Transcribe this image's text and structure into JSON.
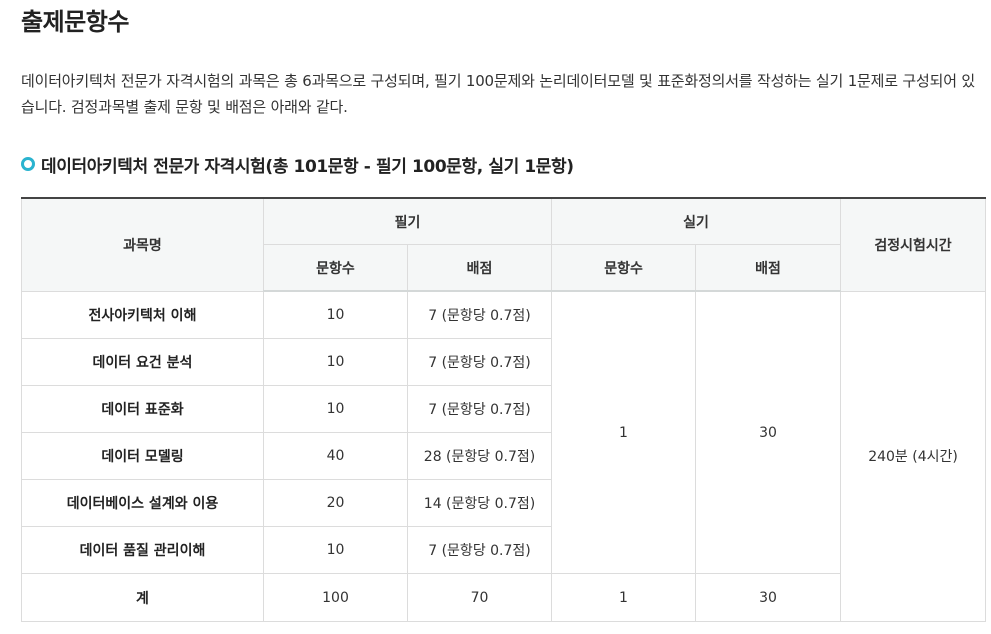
{
  "page_title": "출제문항수",
  "intro": "데이터아키텍처 전문가 자격시험의 과목은 총 6과목으로 구성되며, 필기 100문제와 논리데이터모델 및 표준화정의서를 작성하는 실기 1문제로 구성되어 있습니다. 검정과목별 출제 문항 및 배점은 아래와 같다.",
  "section_title": "데이터아키텍처 전문가 자격시험(총 101문항 - 필기 100문항, 실기 1문항)",
  "table": {
    "headers": {
      "subject": "과목명",
      "written": "필기",
      "practical": "실기",
      "exam_time": "검정시험시간",
      "question_count": "문항수",
      "score": "배점"
    },
    "rows": [
      {
        "subject": "전사아키텍처 이해",
        "written_count": "10",
        "written_score": "7 (문항당 0.7점)"
      },
      {
        "subject": "데이터 요건 분석",
        "written_count": "10",
        "written_score": "7 (문항당 0.7점)"
      },
      {
        "subject": "데이터 표준화",
        "written_count": "10",
        "written_score": "7 (문항당 0.7점)"
      },
      {
        "subject": "데이터 모델링",
        "written_count": "40",
        "written_score": "28 (문항당 0.7점)"
      },
      {
        "subject": "데이터베이스 설계와 이용",
        "written_count": "20",
        "written_score": "14 (문항당 0.7점)"
      },
      {
        "subject": "데이터 품질 관리이해",
        "written_count": "10",
        "written_score": "7 (문항당 0.7점)"
      }
    ],
    "practical_count": "1",
    "practical_score": "30",
    "exam_time": "240분 (4시간)",
    "total": {
      "label": "계",
      "written_count": "100",
      "written_score": "70",
      "practical_count": "1",
      "practical_score": "30"
    }
  }
}
